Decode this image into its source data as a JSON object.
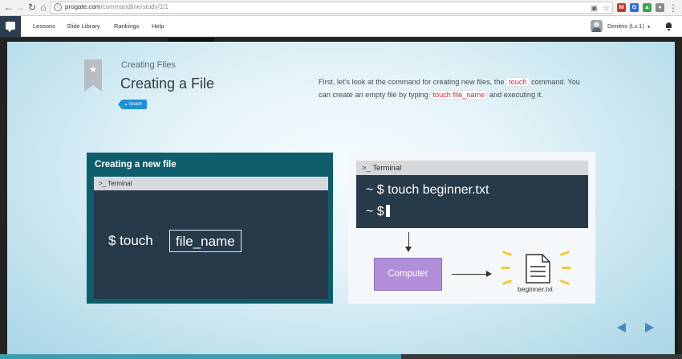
{
  "browser": {
    "url_host": "progate.com",
    "url_path": "/commandline/study/1/1",
    "icons": [
      "back-icon",
      "forward-icon",
      "reload-icon",
      "home-icon",
      "info-icon",
      "translate-icon",
      "star-icon",
      "menu-icon"
    ]
  },
  "header": {
    "nav": [
      "Lessons",
      "Slide Library",
      "Rankings",
      "Help"
    ],
    "user_name": "Dimitris (Lv.1)"
  },
  "lesson": {
    "subtitle": "Creating Files",
    "title": "Creating a File",
    "tag": "touch",
    "description": {
      "part1": "First, let's look at the command for creating new files, the ",
      "code1": "touch",
      "part2": " command. You can create an empty file by typing ",
      "code2": "touch file_name",
      "part3": " and executing it."
    }
  },
  "card_left": {
    "title": "Creating a new file",
    "terminal_label": "Terminal",
    "command": "$ touch",
    "argument": "file_name"
  },
  "card_right": {
    "terminal_label": "Terminal",
    "line1": "~ $ touch beginner.txt",
    "line2": "~ $",
    "computer_label": "Computer",
    "file_name": "beginner.txt"
  },
  "colors": {
    "card_left_bg": "#0e5d6c",
    "terminal_bg": "#263a4a",
    "computer_bg": "#b18fd8",
    "tag_bg": "#1e8fd5",
    "code_text": "#c7254e",
    "nav_arrow": "#4a89c6",
    "spark": "#f0ca34"
  }
}
